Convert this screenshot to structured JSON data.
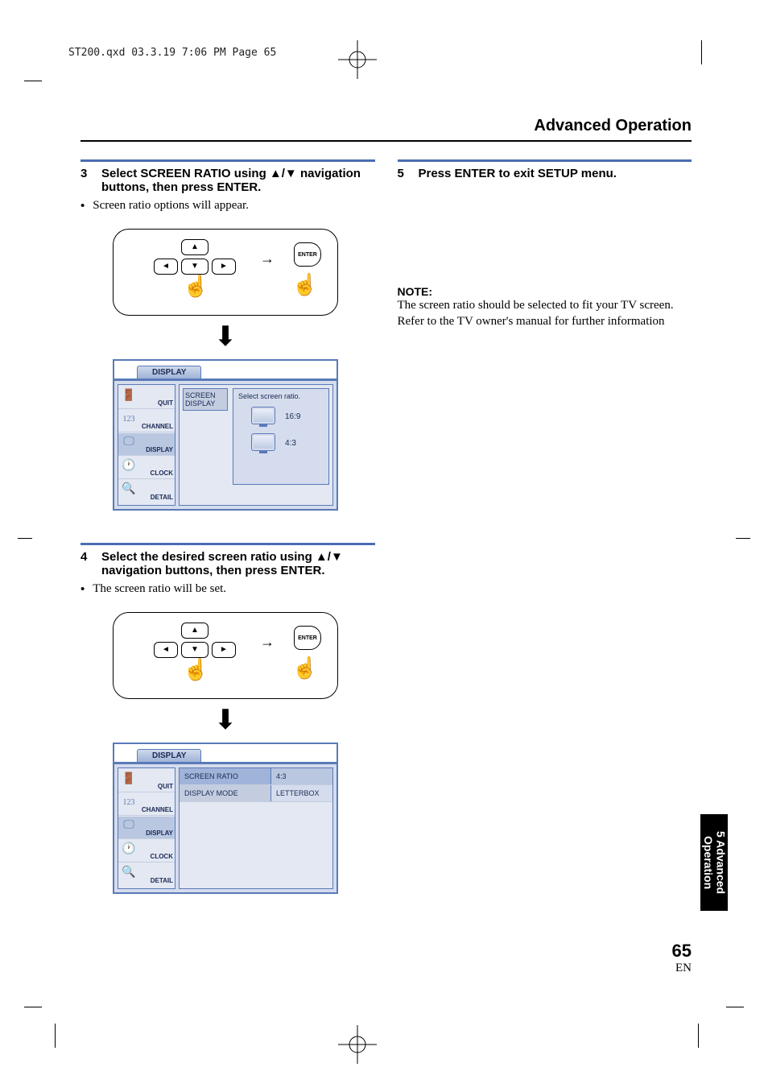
{
  "header_line": "ST200.qxd  03.3.19 7:06 PM  Page 65",
  "section_title": "Advanced Operation",
  "steps": {
    "s3": {
      "num": "3",
      "head": "Select SCREEN RATIO using ▲/▼ navigation buttons, then press ENTER.",
      "bullet": "Screen ratio options will appear."
    },
    "s4": {
      "num": "4",
      "head": "Select the desired screen ratio using ▲/▼ navigation buttons, then press ENTER.",
      "bullet": "The screen ratio will be set."
    },
    "s5": {
      "num": "5",
      "head": "Press ENTER to exit SETUP menu."
    }
  },
  "remote": {
    "enter": "ENTER"
  },
  "osd": {
    "tab": "DISPLAY",
    "side": {
      "quit": "QUIT",
      "channel": "CHANNEL",
      "display": "DISPLAY",
      "clock": "CLOCK",
      "detail": "DETAIL"
    },
    "screen1": {
      "box_line1": "SCREEN",
      "box_line2": "DISPLAY",
      "title": "Select  screen  ratio.",
      "opt1": "16:9",
      "opt2": "4:3"
    },
    "screen2": {
      "row1_key": "SCREEN RATIO",
      "row1_val": "4:3",
      "row2_key": "DISPLAY MODE",
      "row2_val": "LETTERBOX"
    }
  },
  "note": {
    "label": "NOTE:",
    "text1": "The screen ratio should be selected to fit your TV screen.",
    "text2": "Refer to the TV owner's manual for further information"
  },
  "sidetab": "5 Advanced Operation",
  "page": {
    "n": "65",
    "lang": "EN"
  }
}
